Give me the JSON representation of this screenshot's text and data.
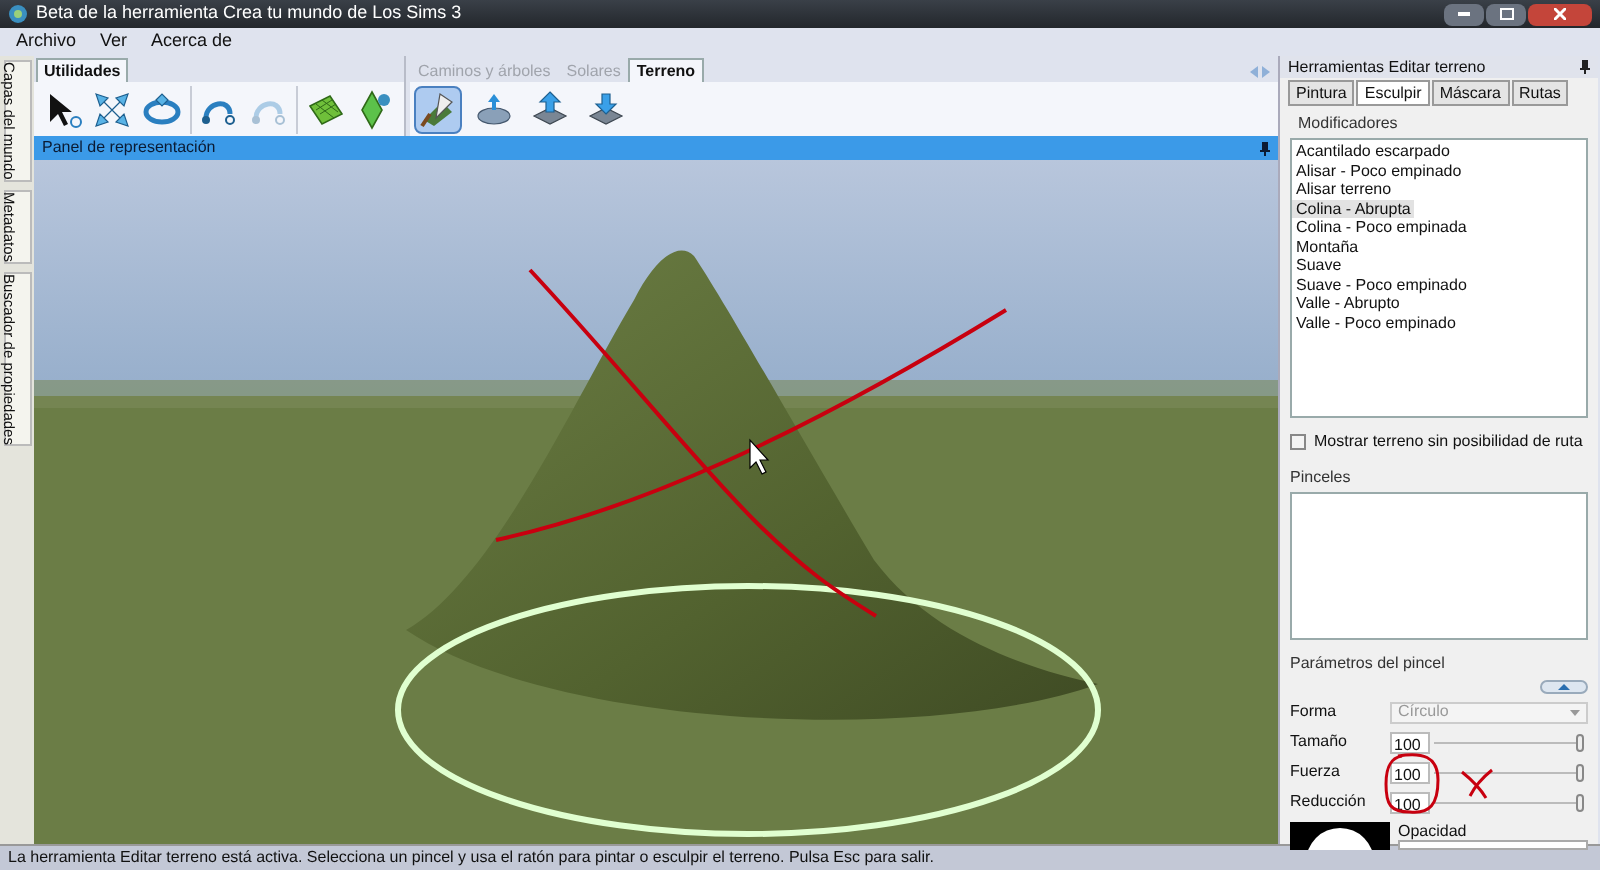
{
  "window": {
    "title": "Beta de la herramienta Crea tu mundo de Los Sims 3"
  },
  "menu": [
    "Archivo",
    "Ver",
    "Acerca de"
  ],
  "side_tabs": [
    "Capas del mundo",
    "Metadatos",
    "Buscador de propiedades"
  ],
  "toolbar_left": {
    "tabs": [
      {
        "label": "Utilidades",
        "selected": true
      }
    ],
    "tools": [
      {
        "kind": "select",
        "disabled": false
      },
      {
        "kind": "move",
        "disabled": false
      },
      {
        "kind": "rotate",
        "disabled": false
      },
      {
        "kind": "undo",
        "disabled": false
      },
      {
        "kind": "undo",
        "disabled": true
      },
      {
        "kind": "grid",
        "disabled": false
      },
      {
        "kind": "plumbob",
        "disabled": false
      }
    ]
  },
  "toolbar_right": {
    "tabs": [
      {
        "label": "Caminos y árboles",
        "selected": false,
        "disabled": true
      },
      {
        "label": "Solares",
        "selected": false,
        "disabled": true
      },
      {
        "label": "Terreno",
        "selected": true,
        "disabled": false
      }
    ],
    "tools": [
      {
        "kind": "paint",
        "selected": true
      },
      {
        "kind": "sculpt",
        "selected": false
      },
      {
        "kind": "raise",
        "selected": false
      },
      {
        "kind": "lower",
        "selected": false
      }
    ]
  },
  "viewport": {
    "title": "Panel de representación"
  },
  "panel": {
    "title": "Herramientas Editar terreno",
    "tabs": [
      {
        "label": "Pintura",
        "selected": false
      },
      {
        "label": "Esculpir",
        "selected": true
      },
      {
        "label": "Máscara",
        "selected": false
      },
      {
        "label": "Rutas",
        "selected": false
      }
    ],
    "modifiers": {
      "label": "Modificadores",
      "items": [
        {
          "label": "Acantilado escarpado",
          "selected": false
        },
        {
          "label": "Alisar - Poco empinado",
          "selected": false
        },
        {
          "label": "Alisar terreno",
          "selected": false
        },
        {
          "label": "Colina - Abrupta",
          "selected": true
        },
        {
          "label": "Colina - Poco empinada",
          "selected": false
        },
        {
          "label": "Montaña",
          "selected": false
        },
        {
          "label": "Suave",
          "selected": false
        },
        {
          "label": "Suave - Poco empinado",
          "selected": false
        },
        {
          "label": "Valle - Abrupto",
          "selected": false
        },
        {
          "label": "Valle - Poco empinado",
          "selected": false
        }
      ]
    },
    "route_checkbox": {
      "label": "Mostrar terreno sin posibilidad de ruta",
      "checked": false
    },
    "brushes": {
      "label": "Pinceles"
    },
    "params": {
      "label": "Parámetros del pincel",
      "fields": [
        {
          "kind": "select",
          "label": "Forma",
          "value": "Círculo",
          "disabled": true
        },
        {
          "kind": "slider",
          "label": "Tamaño",
          "value": "100",
          "level": 1
        },
        {
          "kind": "slider",
          "label": "Fuerza",
          "value": "100",
          "level": 1
        },
        {
          "kind": "slider",
          "label": "Reducción",
          "value": "100",
          "level": 1
        }
      ]
    },
    "opacity": {
      "label": "Opacidad"
    }
  },
  "status_bar": "La herramienta Editar terreno está activa. Selecciona un pincel y usa el ratón para pintar o esculpir el terreno. Pulsa Esc para salir."
}
